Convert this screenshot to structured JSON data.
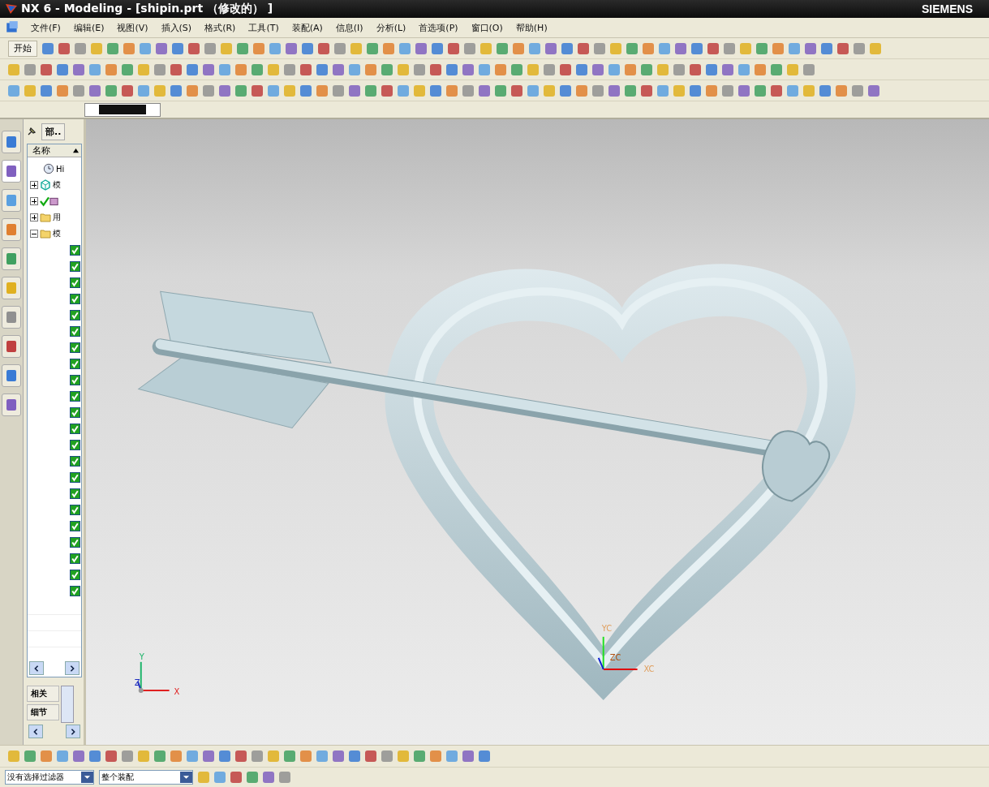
{
  "window": {
    "title": "NX 6 - Modeling - [shipin.prt （修改的） ]",
    "brand": "SIEMENS"
  },
  "menu": [
    {
      "label": "文件(F)"
    },
    {
      "label": "编辑(E)"
    },
    {
      "label": "视图(V)"
    },
    {
      "label": "插入(S)"
    },
    {
      "label": "格式(R)"
    },
    {
      "label": "工具(T)"
    },
    {
      "label": "装配(A)"
    },
    {
      "label": "信息(I)"
    },
    {
      "label": "分析(L)"
    },
    {
      "label": "首选项(P)"
    },
    {
      "label": "窗口(O)"
    },
    {
      "label": "帮助(H)"
    }
  ],
  "toolbar": {
    "start_button": "开始"
  },
  "resource_tabs": [
    {
      "selected": false
    },
    {
      "selected": true
    },
    {
      "selected": false
    },
    {
      "selected": false
    },
    {
      "selected": false
    },
    {
      "selected": false
    },
    {
      "selected": false
    },
    {
      "selected": false
    },
    {
      "selected": false
    },
    {
      "selected": false
    }
  ],
  "navigator": {
    "tab": "部..",
    "column": "名称",
    "tree": [
      {
        "label": "Hi",
        "kind": "history"
      },
      {
        "label": "模",
        "kind": "model",
        "expanded": false
      },
      {
        "kind": "check",
        "expanded": false
      },
      {
        "label": "用",
        "kind": "folder",
        "expanded": false
      },
      {
        "label": "模",
        "kind": "folder",
        "expanded": true,
        "children": [
          {
            "checked": true
          },
          {
            "checked": true
          },
          {
            "checked": true
          },
          {
            "checked": true
          },
          {
            "checked": true
          },
          {
            "checked": true
          },
          {
            "checked": true
          },
          {
            "checked": true
          },
          {
            "checked": true
          },
          {
            "checked": true
          },
          {
            "checked": true
          },
          {
            "checked": true
          },
          {
            "checked": true
          },
          {
            "checked": true
          },
          {
            "checked": true
          },
          {
            "checked": true
          },
          {
            "checked": true
          },
          {
            "checked": true
          },
          {
            "checked": true
          },
          {
            "checked": true
          },
          {
            "checked": true
          },
          {
            "checked": true
          }
        ]
      }
    ],
    "panels": [
      "相关",
      "细节"
    ]
  },
  "viewport": {
    "triad_labels": [
      "Y",
      "Z",
      "X"
    ],
    "wcs_labels": [
      "YC",
      "ZC",
      "XC"
    ]
  },
  "status": {
    "selection_filter": "没有选择过滤器",
    "scope": "整个装配"
  }
}
